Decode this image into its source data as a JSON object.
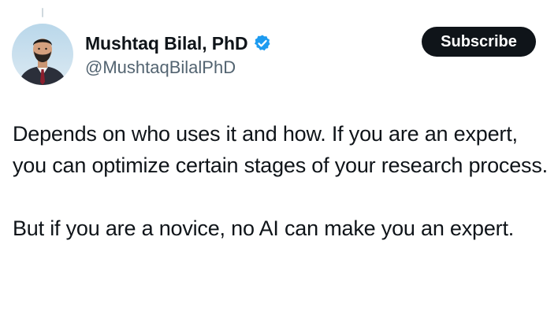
{
  "author": {
    "display_name": "Mushtaq Bilal, PhD",
    "handle": "@MushtaqBilalPhD",
    "verified": true,
    "avatar_icon": "profile-photo"
  },
  "actions": {
    "subscribe_label": "Subscribe"
  },
  "tweet": {
    "paragraphs": [
      "Depends on who uses it and how. If you are an expert, you can optimize certain stages of your research process.",
      "But if you are a novice, no AI can make you an expert."
    ]
  },
  "colors": {
    "text": "#0f1419",
    "secondary_text": "#536471",
    "verified_badge": "#1d9bf0",
    "button_bg": "#0f1419",
    "button_text": "#ffffff"
  }
}
